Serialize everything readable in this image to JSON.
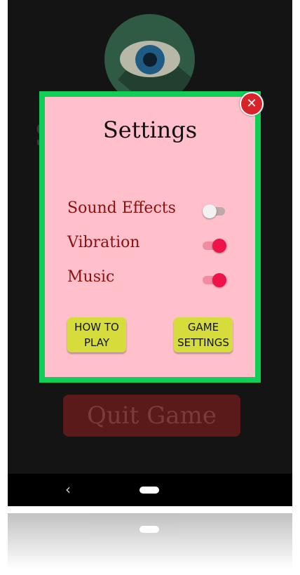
{
  "dialog": {
    "title": "Settings",
    "close_icon": "close-icon",
    "settings": [
      {
        "label": "Sound Effects",
        "enabled": false
      },
      {
        "label": "Vibration",
        "enabled": true
      },
      {
        "label": "Music",
        "enabled": true
      }
    ],
    "how_to_play_label": "HOW TO\nPLAY",
    "game_settings_label": "GAME\nSETTINGS"
  },
  "background": {
    "quit_label": "Quit Game",
    "logo_icon": "eye-icon"
  },
  "navbar": {
    "back_glyph": "‹"
  },
  "colors": {
    "dialog_bg": "#ffc0cb",
    "dialog_border": "#0fcf56",
    "label_color": "#8b1010",
    "toggle_on": "#f0124a",
    "button_yellow": "#d6dc3c",
    "close_red": "#d9222a"
  }
}
